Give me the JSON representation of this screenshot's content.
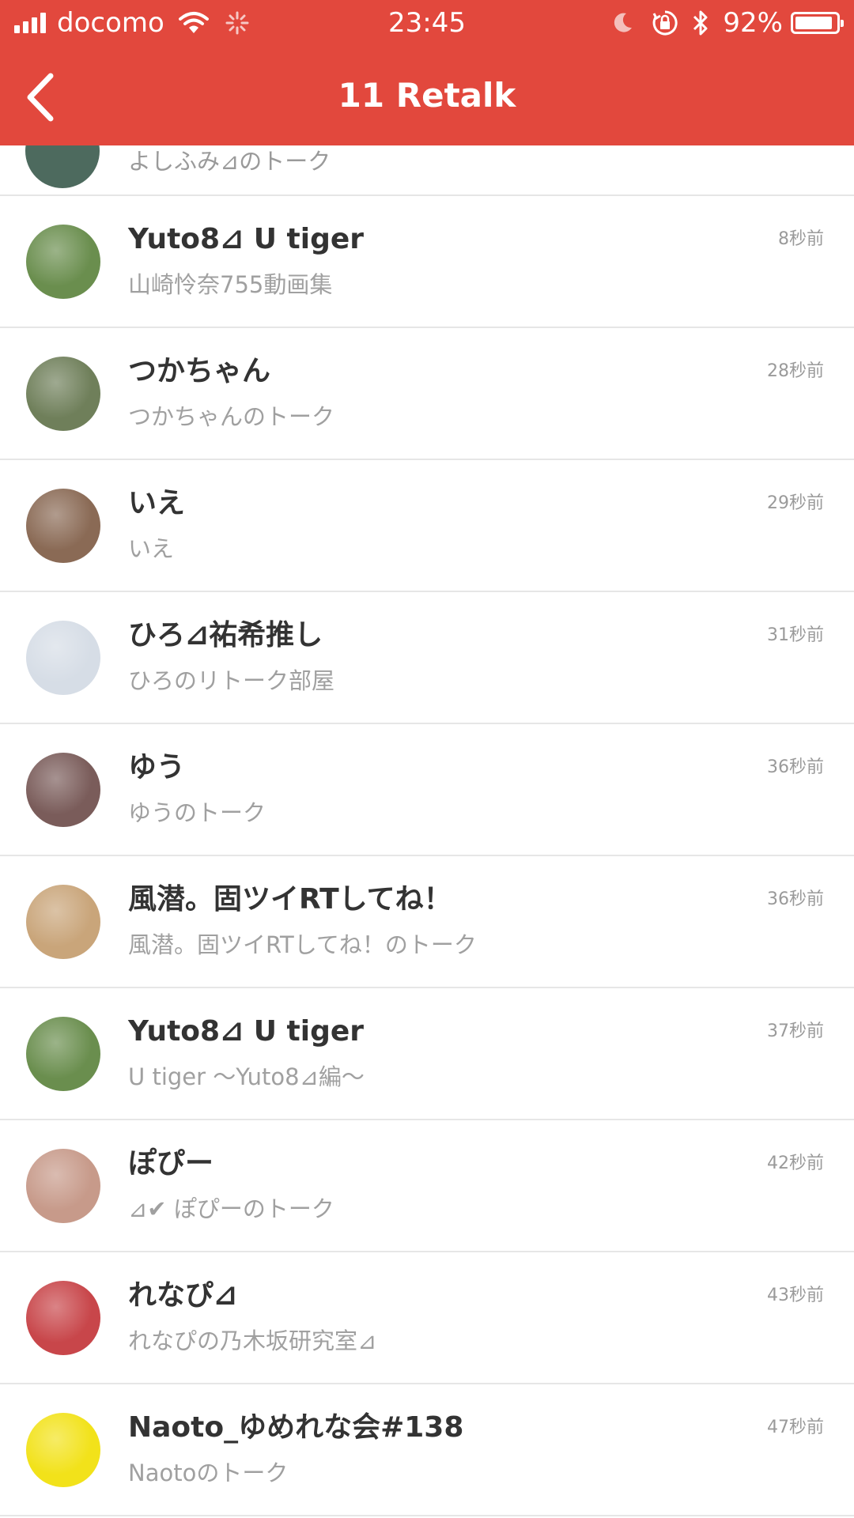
{
  "status_bar": {
    "carrier": "docomo",
    "time": "23:45",
    "battery_percent": "92%",
    "battery_level": 0.92
  },
  "nav": {
    "title": "11 Retalk",
    "back_icon": "chevron-left-icon"
  },
  "partial_row": {
    "subtitle": "よしふみ⊿のトーク"
  },
  "rows": [
    {
      "name": "Yuto8⊿ U tiger",
      "subtitle": "山崎怜奈755動画集",
      "time": "8秒前",
      "avatar_color": "#6a8e4e"
    },
    {
      "name": "つかちゃん",
      "subtitle": "つかちゃんのトーク",
      "time": "28秒前",
      "avatar_color": "#6f7f5a"
    },
    {
      "name": "いえ",
      "subtitle": "いえ",
      "time": "29秒前",
      "avatar_color": "#8a6a55"
    },
    {
      "name": "ひろ⊿祐希推し",
      "subtitle": "ひろのリトーク部屋",
      "time": "31秒前",
      "avatar_color": "#d6dde6"
    },
    {
      "name": "ゆう",
      "subtitle": "ゆうのトーク",
      "time": "36秒前",
      "avatar_color": "#7a5c5a"
    },
    {
      "name": "風潜。固ツイRTしてね！",
      "subtitle": "風潜。固ツイRTしてね！のトーク",
      "time": "36秒前",
      "avatar_color": "#c9a57a"
    },
    {
      "name": "Yuto8⊿ U tiger",
      "subtitle": "U tiger 〜Yuto8⊿編〜",
      "time": "37秒前",
      "avatar_color": "#6a8e4e"
    },
    {
      "name": "ぽぴー",
      "subtitle": "⊿✔ ぽぴーのトーク",
      "time": "42秒前",
      "avatar_color": "#c79a8a"
    },
    {
      "name": "れなぴ⊿",
      "subtitle": "れなぴの乃木坂研究室⊿",
      "time": "43秒前",
      "avatar_color": "#c8464a"
    },
    {
      "name": "Naoto_ゆめれな会#138",
      "subtitle": "Naotoのトーク",
      "time": "47秒前",
      "avatar_color": "#f2e21a"
    }
  ]
}
